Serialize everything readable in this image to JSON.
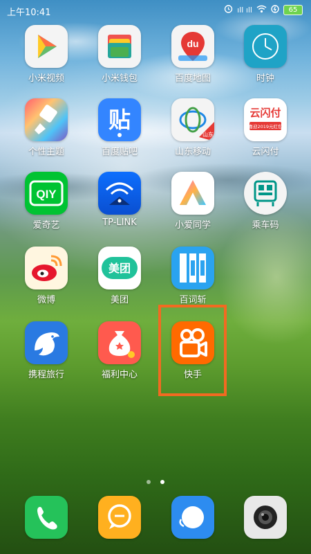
{
  "status_bar": {
    "time": "上午10:41",
    "signal_text": "ıll ıll",
    "battery": "65"
  },
  "apps": [
    {
      "label": "小米视频",
      "icon": "play-icon"
    },
    {
      "label": "小米钱包",
      "icon": "wallet-icon"
    },
    {
      "label": "百度地图",
      "icon": "map-pin-icon",
      "icon_text": "du"
    },
    {
      "label": "时钟",
      "icon": "clock-icon"
    },
    {
      "label": "个性主题",
      "icon": "brush-icon"
    },
    {
      "label": "百度贴吧",
      "icon": "tieba-icon",
      "icon_text": "贴"
    },
    {
      "label": "山东移动",
      "icon": "china-mobile-icon",
      "badge": "山东"
    },
    {
      "label": "云闪付",
      "icon": "unionpay-icon",
      "icon_text": "云闪付",
      "sub_text": "喜迎2019元红包"
    },
    {
      "label": "爱奇艺",
      "icon": "iqiyi-icon",
      "icon_text": "QIY"
    },
    {
      "label": "TP-LINK",
      "icon": "wifi-icon"
    },
    {
      "label": "小爱同学",
      "icon": "xiaoai-icon"
    },
    {
      "label": "乘车码",
      "icon": "bus-code-icon"
    },
    {
      "label": "微博",
      "icon": "weibo-icon"
    },
    {
      "label": "美团",
      "icon": "meituan-icon",
      "icon_text": "美团"
    },
    {
      "label": "百词斩",
      "icon": "baicizhan-icon"
    },
    {
      "label": "携程旅行",
      "icon": "dolphin-icon"
    },
    {
      "label": "福利中心",
      "icon": "money-bag-icon"
    },
    {
      "label": "快手",
      "icon": "kuaishou-icon"
    }
  ],
  "dock": [
    {
      "name": "phone",
      "icon": "phone-icon"
    },
    {
      "name": "messages",
      "icon": "message-icon"
    },
    {
      "name": "browser",
      "icon": "browser-icon"
    },
    {
      "name": "camera",
      "icon": "camera-icon"
    }
  ],
  "page_indicator": {
    "pages": 2,
    "current": 2
  },
  "highlight_color": "#f26a21"
}
